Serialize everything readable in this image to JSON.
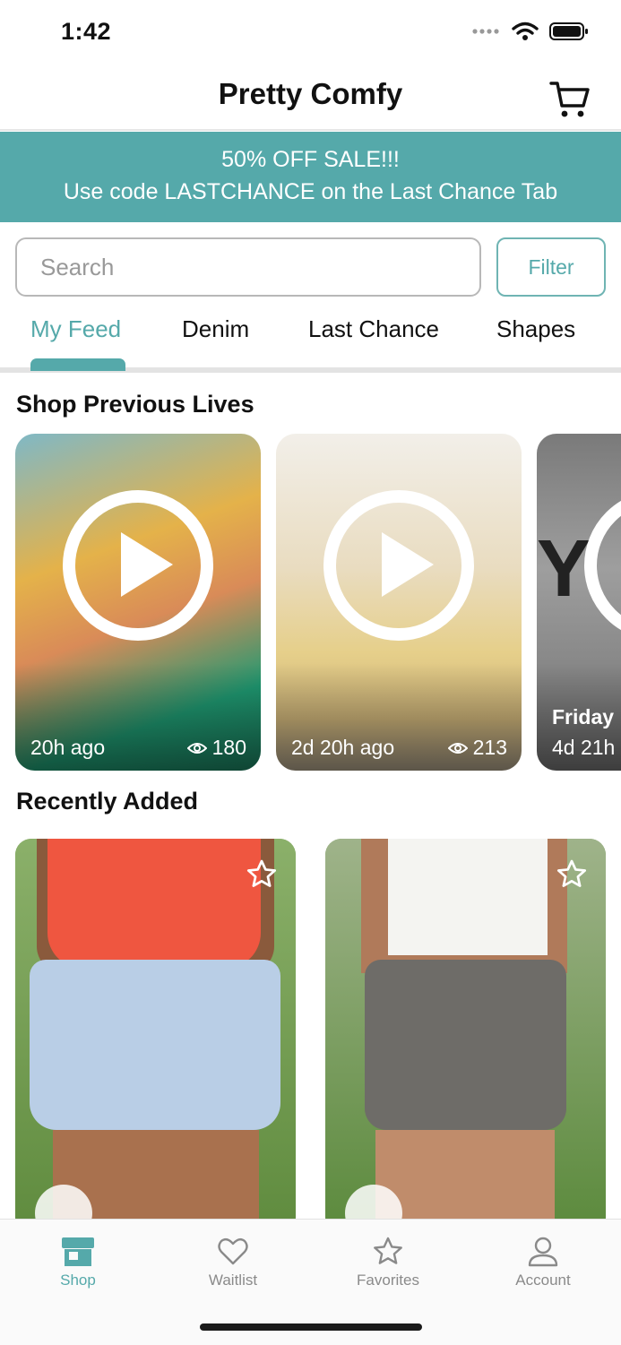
{
  "status_bar": {
    "time": "1:42"
  },
  "header": {
    "title": "Pretty Comfy"
  },
  "banner": {
    "line1": "50% OFF SALE!!!",
    "line2": "Use code LASTCHANCE on the Last Chance Tab"
  },
  "search": {
    "placeholder": "Search",
    "filter_label": "Filter"
  },
  "tabs": [
    {
      "label": "My Feed",
      "active": true
    },
    {
      "label": "Denim"
    },
    {
      "label": "Last Chance"
    },
    {
      "label": "Shapes"
    }
  ],
  "sections": {
    "previous_lives": "Shop Previous Lives",
    "recently_added": "Recently Added"
  },
  "live_cards": [
    {
      "time": "20h ago",
      "views": "180"
    },
    {
      "time": "2d 20h ago",
      "views": "213"
    },
    {
      "title": "Friday",
      "time": "4d 21h"
    }
  ],
  "bottom_nav": [
    {
      "label": "Shop",
      "icon": "shop-icon",
      "active": true
    },
    {
      "label": "Waitlist",
      "icon": "heart-icon"
    },
    {
      "label": "Favorites",
      "icon": "star-icon"
    },
    {
      "label": "Account",
      "icon": "account-icon"
    }
  ],
  "colors": {
    "accent": "#55a9aa"
  }
}
